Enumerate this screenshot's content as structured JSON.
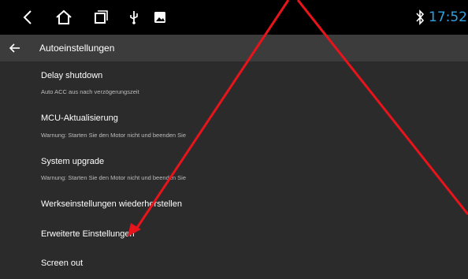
{
  "status_bar": {
    "time": "17:52",
    "icons": [
      "back-icon",
      "home-icon",
      "recents-icon",
      "usb-icon",
      "gallery-icon",
      "bluetooth-icon"
    ],
    "time_color": "#2ea3e0"
  },
  "header": {
    "title": "Autoeinstellungen",
    "back_icon": "arrow-left-icon"
  },
  "settings": {
    "items": [
      {
        "title": "Delay shutdown",
        "subtitle": "Auto ACC aus nach verzögerungszeit"
      },
      {
        "title": "MCU-Aktualisierung",
        "subtitle": "Warnung: Starten Sie den Motor nicht und beenden Sie"
      },
      {
        "title": "System upgrade",
        "subtitle": "Warnung: Starten Sie den Motor nicht und beenden Sie"
      },
      {
        "title": "Werkseinstellungen wiederherstellen"
      },
      {
        "title": "Erweiterte Einstellungen"
      },
      {
        "title": "Screen out"
      }
    ]
  },
  "annotation": {
    "color": "#e8141b",
    "shape": "red-arrow-lines"
  }
}
